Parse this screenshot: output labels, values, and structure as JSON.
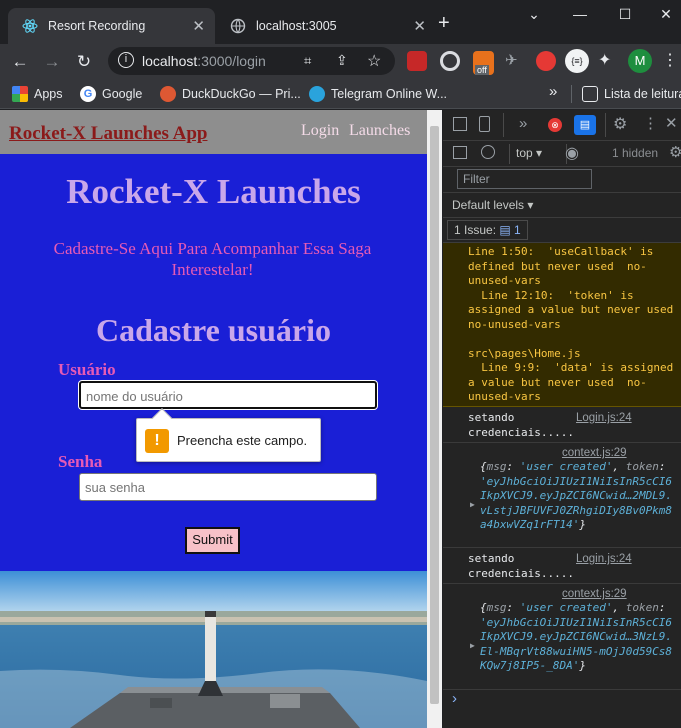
{
  "tabs": [
    {
      "title": "Resort Recording",
      "active": true
    },
    {
      "title": "localhost:3005",
      "active": false
    }
  ],
  "window": {
    "minimize": "⌄",
    "min": "—",
    "max": "☐",
    "close": "✕"
  },
  "toolbar": {
    "url_host": "localhost",
    "url_rest": ":3000/login",
    "profile_initial": "M",
    "ext_badge": "off"
  },
  "bookmarks": {
    "items": [
      "Apps",
      "Google",
      "DuckDuckGo — Pri...",
      "Telegram Online W..."
    ],
    "overflow": "»",
    "reading_list": "Lista de leitura"
  },
  "page": {
    "brand": "Rocket-X Launches App",
    "nav": [
      "Login",
      "Launches"
    ],
    "hero_title": "Rocket-X Launches",
    "hero_subtitle": "Cadastre-Se Aqui Para Acompanhar Essa Saga Interestelar!",
    "form_title": "Cadastre usuário",
    "user_label": "Usuário",
    "user_placeholder": "nome do usuário",
    "pass_label": "Senha",
    "pass_placeholder": "sua senha",
    "submit": "Submit",
    "validation_message": "Preencha este campo."
  },
  "devtools": {
    "context": "top",
    "hidden": "1 hidden",
    "filter_placeholder": "Filter",
    "levels": "Default levels",
    "issues": "1 Issue:",
    "issues_count": "1",
    "warning_text": "Line 1:50:  'useCallback' is defined but never used  no-unused-vars\n  Line 12:10:  'token' is assigned a value but never used  no-unused-vars\n\nsrc\\pages\\Home.js\n  Line 9:9:  'data' is assigned a value but never used  no-unused-vars",
    "logs": [
      {
        "text": "setando credenciais.....",
        "source": "Login.js:24"
      },
      {
        "source": "context.js:29",
        "msg_key": "msg",
        "msg_val": "'user created'",
        "token_key": "token",
        "token_val": "'eyJhbGciOiJIUzI1NiIsInR5cCI6IkpXVCJ9.eyJpZCI6NCwid…2MDL9.vLstjJBFUVFJ0ZRhgiDIy8Bv0Pkm8a4bxwVZq1rFT14'"
      },
      {
        "text": "setando credenciais.....",
        "source": "Login.js:24"
      },
      {
        "source": "context.js:29",
        "msg_key": "msg",
        "msg_val": "'user created'",
        "token_key": "token",
        "token_val": "'eyJhbGciOiJIUzI1NiIsInR5cCI6IkpXVCJ9.eyJpZCI6NCwid…3NzL9.El-MBqrVt88wuiHN5-mOjJ0d59Cs8KQw7j8IP5-_8DA'"
      }
    ],
    "prompt": "›"
  },
  "colors": {
    "page_bg": "#1a1fd6",
    "title": "#c9a7ea",
    "accent_pink": "#e65bb5",
    "brand": "#8b1a1a"
  }
}
